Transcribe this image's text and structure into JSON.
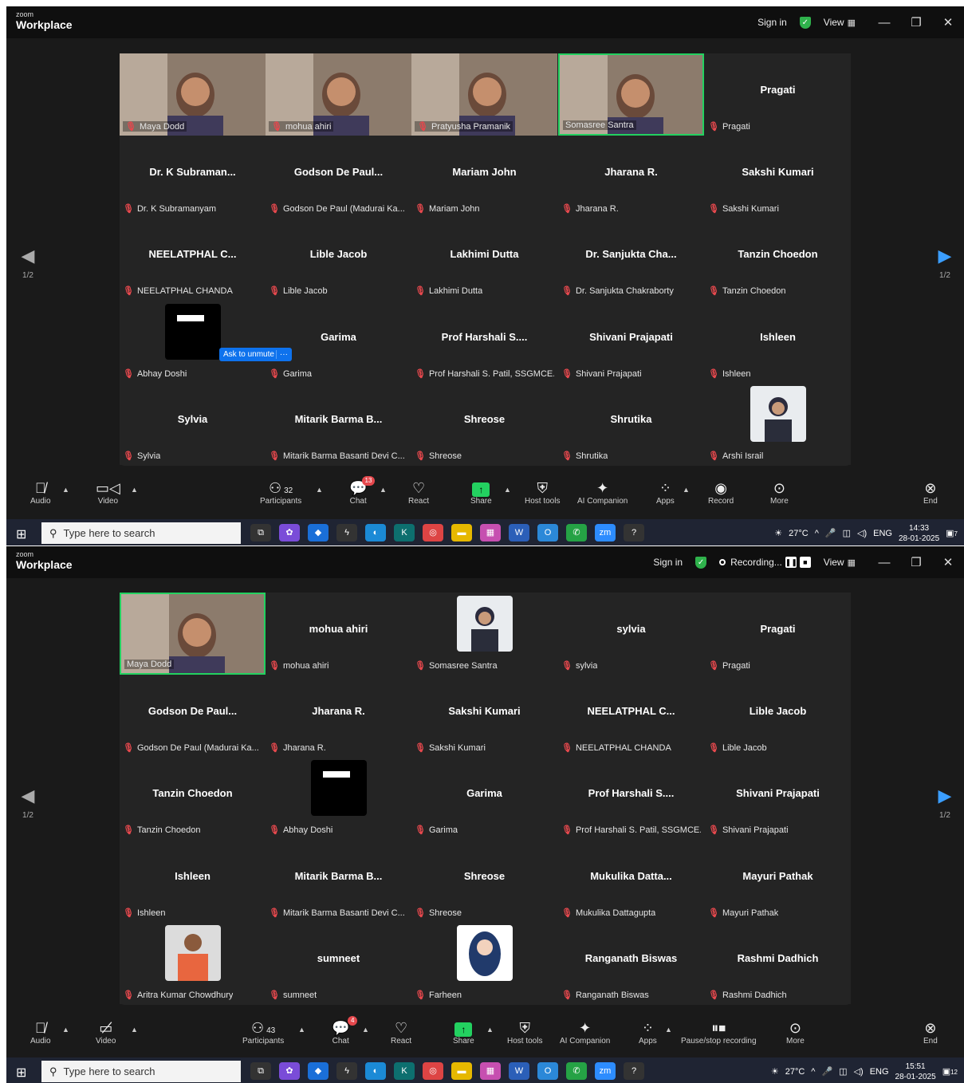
{
  "shot1": {
    "logo_small": "zoom",
    "logo_big": "Workplace",
    "sign_in": "Sign in",
    "view": "View",
    "page_left": "1/2",
    "page_right": "1/2",
    "ask_unmute": "Ask to unmute",
    "ask_more": "···",
    "tiles": [
      {
        "big": "",
        "label": "Maya Dodd",
        "video": true
      },
      {
        "big": "",
        "label": "mohua ahiri",
        "video": true
      },
      {
        "big": "",
        "label": "Pratyusha Pramanik",
        "video": true
      },
      {
        "big": "",
        "label": "Somasree Santra",
        "video": true,
        "active": true
      },
      {
        "big": "Pragati",
        "label": "Pragati"
      },
      {
        "big": "Dr. K Subraman...",
        "label": "Dr. K Subramanyam"
      },
      {
        "big": "Godson De Paul...",
        "label": "Godson De Paul (Madurai Ka..."
      },
      {
        "big": "Mariam John",
        "label": "Mariam John"
      },
      {
        "big": "Jharana R.",
        "label": "Jharana R."
      },
      {
        "big": "Sakshi Kumari",
        "label": "Sakshi Kumari"
      },
      {
        "big": "NEELATPHAL C...",
        "label": "NEELATPHAL CHANDA"
      },
      {
        "big": "Lible Jacob",
        "label": "Lible Jacob"
      },
      {
        "big": "Lakhimi Dutta",
        "label": "Lakhimi Dutta"
      },
      {
        "big": "Dr. Sanjukta Cha...",
        "label": "Dr. Sanjukta Chakraborty"
      },
      {
        "big": "Tanzin Choedon",
        "label": "Tanzin Choedon"
      },
      {
        "big": "",
        "label": "Abhay Doshi",
        "avatar": "black"
      },
      {
        "big": "Garima",
        "label": "Garima"
      },
      {
        "big": "Prof Harshali S....",
        "label": "Prof Harshali S. Patil, SSGMCE..."
      },
      {
        "big": "Shivani Prajapati",
        "label": "Shivani Prajapati"
      },
      {
        "big": "Ishleen",
        "label": "Ishleen"
      },
      {
        "big": "Sylvia",
        "label": "Sylvia"
      },
      {
        "big": "Mitarik Barma B...",
        "label": "Mitarik Barma Basanti Devi C..."
      },
      {
        "big": "Shreose",
        "label": "Shreose"
      },
      {
        "big": "Shrutika",
        "label": "Shrutika"
      },
      {
        "big": "",
        "label": "Arshi Israil",
        "avatar": "photo"
      }
    ],
    "toolbar": {
      "audio": "Audio",
      "video": "Video",
      "participants": "Participants",
      "participants_count": "32",
      "chat": "Chat",
      "chat_badge": "13",
      "react": "React",
      "share": "Share",
      "host_tools": "Host tools",
      "ai": "AI Companion",
      "apps": "Apps",
      "record": "Record",
      "more": "More",
      "end": "End"
    },
    "taskbar": {
      "search": "Type here to search",
      "temp": "27°C",
      "lang": "ENG",
      "time": "14:33",
      "date": "28-01-2025",
      "notif": "7"
    }
  },
  "shot2": {
    "logo_small": "zoom",
    "logo_big": "Workplace",
    "sign_in": "Sign in",
    "recording": "Recording...",
    "view": "View",
    "page_left": "1/2",
    "page_right": "1/2",
    "tiles": [
      {
        "big": "",
        "label": "Maya Dodd",
        "video": true,
        "active": true
      },
      {
        "big": "mohua ahiri",
        "label": "mohua ahiri"
      },
      {
        "big": "",
        "label": "Somasree Santra",
        "avatar": "photo"
      },
      {
        "big": "sylvia",
        "label": "sylvia"
      },
      {
        "big": "Pragati",
        "label": "Pragati"
      },
      {
        "big": "Godson De Paul...",
        "label": "Godson De Paul (Madurai Ka..."
      },
      {
        "big": "Jharana R.",
        "label": "Jharana R."
      },
      {
        "big": "Sakshi Kumari",
        "label": "Sakshi Kumari"
      },
      {
        "big": "NEELATPHAL C...",
        "label": "NEELATPHAL CHANDA"
      },
      {
        "big": "Lible Jacob",
        "label": "Lible Jacob"
      },
      {
        "big": "Tanzin Choedon",
        "label": "Tanzin Choedon"
      },
      {
        "big": "",
        "label": "Abhay Doshi",
        "avatar": "black"
      },
      {
        "big": "Garima",
        "label": "Garima"
      },
      {
        "big": "Prof Harshali S....",
        "label": "Prof Harshali S. Patil, SSGMCE..."
      },
      {
        "big": "Shivani Prajapati",
        "label": "Shivani Prajapati"
      },
      {
        "big": "Ishleen",
        "label": "Ishleen"
      },
      {
        "big": "Mitarik Barma B...",
        "label": "Mitarik Barma Basanti Devi C..."
      },
      {
        "big": "Shreose",
        "label": "Shreose"
      },
      {
        "big": "Mukulika Datta...",
        "label": "Mukulika Dattagupta"
      },
      {
        "big": "Mayuri Pathak",
        "label": "Mayuri Pathak"
      },
      {
        "big": "",
        "label": "Aritra Kumar Chowdhury",
        "avatar": "photo2"
      },
      {
        "big": "sumneet",
        "label": "sumneet"
      },
      {
        "big": "",
        "label": "Farheen",
        "avatar": "hijab"
      },
      {
        "big": "Ranganath Biswas",
        "label": "Ranganath Biswas"
      },
      {
        "big": "Rashmi Dadhich",
        "label": "Rashmi Dadhich"
      }
    ],
    "toolbar": {
      "audio": "Audio",
      "video": "Video",
      "participants": "Participants",
      "participants_count": "43",
      "chat": "Chat",
      "chat_badge": "4",
      "react": "React",
      "share": "Share",
      "host_tools": "Host tools",
      "ai": "AI Companion",
      "apps": "Apps",
      "record": "Pause/stop recording",
      "more": "More",
      "end": "End"
    },
    "taskbar": {
      "search": "Type here to search",
      "temp": "27°C",
      "lang": "ENG",
      "time": "15:51",
      "date": "28-01-2025",
      "notif": "12"
    }
  }
}
